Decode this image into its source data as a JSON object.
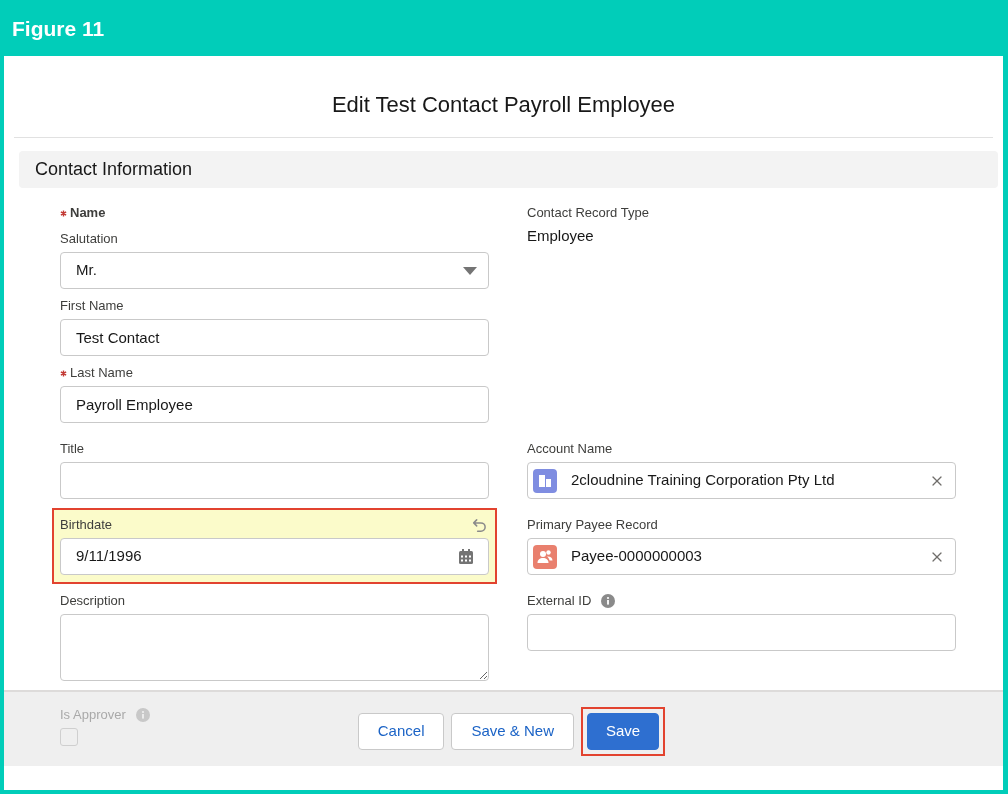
{
  "figure_label": "Figure 11",
  "modal": {
    "title": "Edit Test Contact Payroll Employee"
  },
  "section": {
    "title": "Contact Information"
  },
  "rows": [
    {
      "left": {
        "kind": "name_group",
        "label": "Name",
        "required": true,
        "parts": [
          {
            "kind": "picklist",
            "label": "Salutation",
            "value": "Mr."
          },
          {
            "kind": "text",
            "label": "First Name",
            "value": "Test Contact"
          },
          {
            "kind": "text",
            "label": "Last Name",
            "required": true,
            "value": "Payroll Employee"
          }
        ]
      },
      "right": {
        "kind": "readonly",
        "label": "Contact Record Type",
        "value": "Employee"
      }
    },
    {
      "left": {
        "kind": "text",
        "label": "Title"
      },
      "right": {
        "kind": "account_lookup",
        "label": "Account Name",
        "value": "2cloudnine Training Corporation Pty Ltd",
        "color": "#7f8de1"
      }
    },
    {
      "left": {
        "kind": "date",
        "label": "Birthdate",
        "value": "9/11/1996",
        "changed": true,
        "highlighted": true
      },
      "right": {
        "kind": "payee_lookup",
        "label": "Primary Payee Record",
        "value": "Payee-0000000003",
        "color": "#e9806e"
      }
    },
    {
      "left": {
        "kind": "textarea",
        "label": "Description"
      },
      "right": {
        "kind": "text",
        "label": "External ID",
        "info": true
      }
    }
  ],
  "footer": {
    "obscured_field": {
      "kind": "checkbox",
      "label": "Is Approver",
      "info": true,
      "checked": false
    },
    "buttons": [
      {
        "label": "Cancel",
        "kind": "neutral",
        "highlighted": false
      },
      {
        "label": "Save & New",
        "kind": "neutral",
        "highlighted": false
      },
      {
        "label": "Save",
        "kind": "brand",
        "highlighted": true
      }
    ]
  }
}
